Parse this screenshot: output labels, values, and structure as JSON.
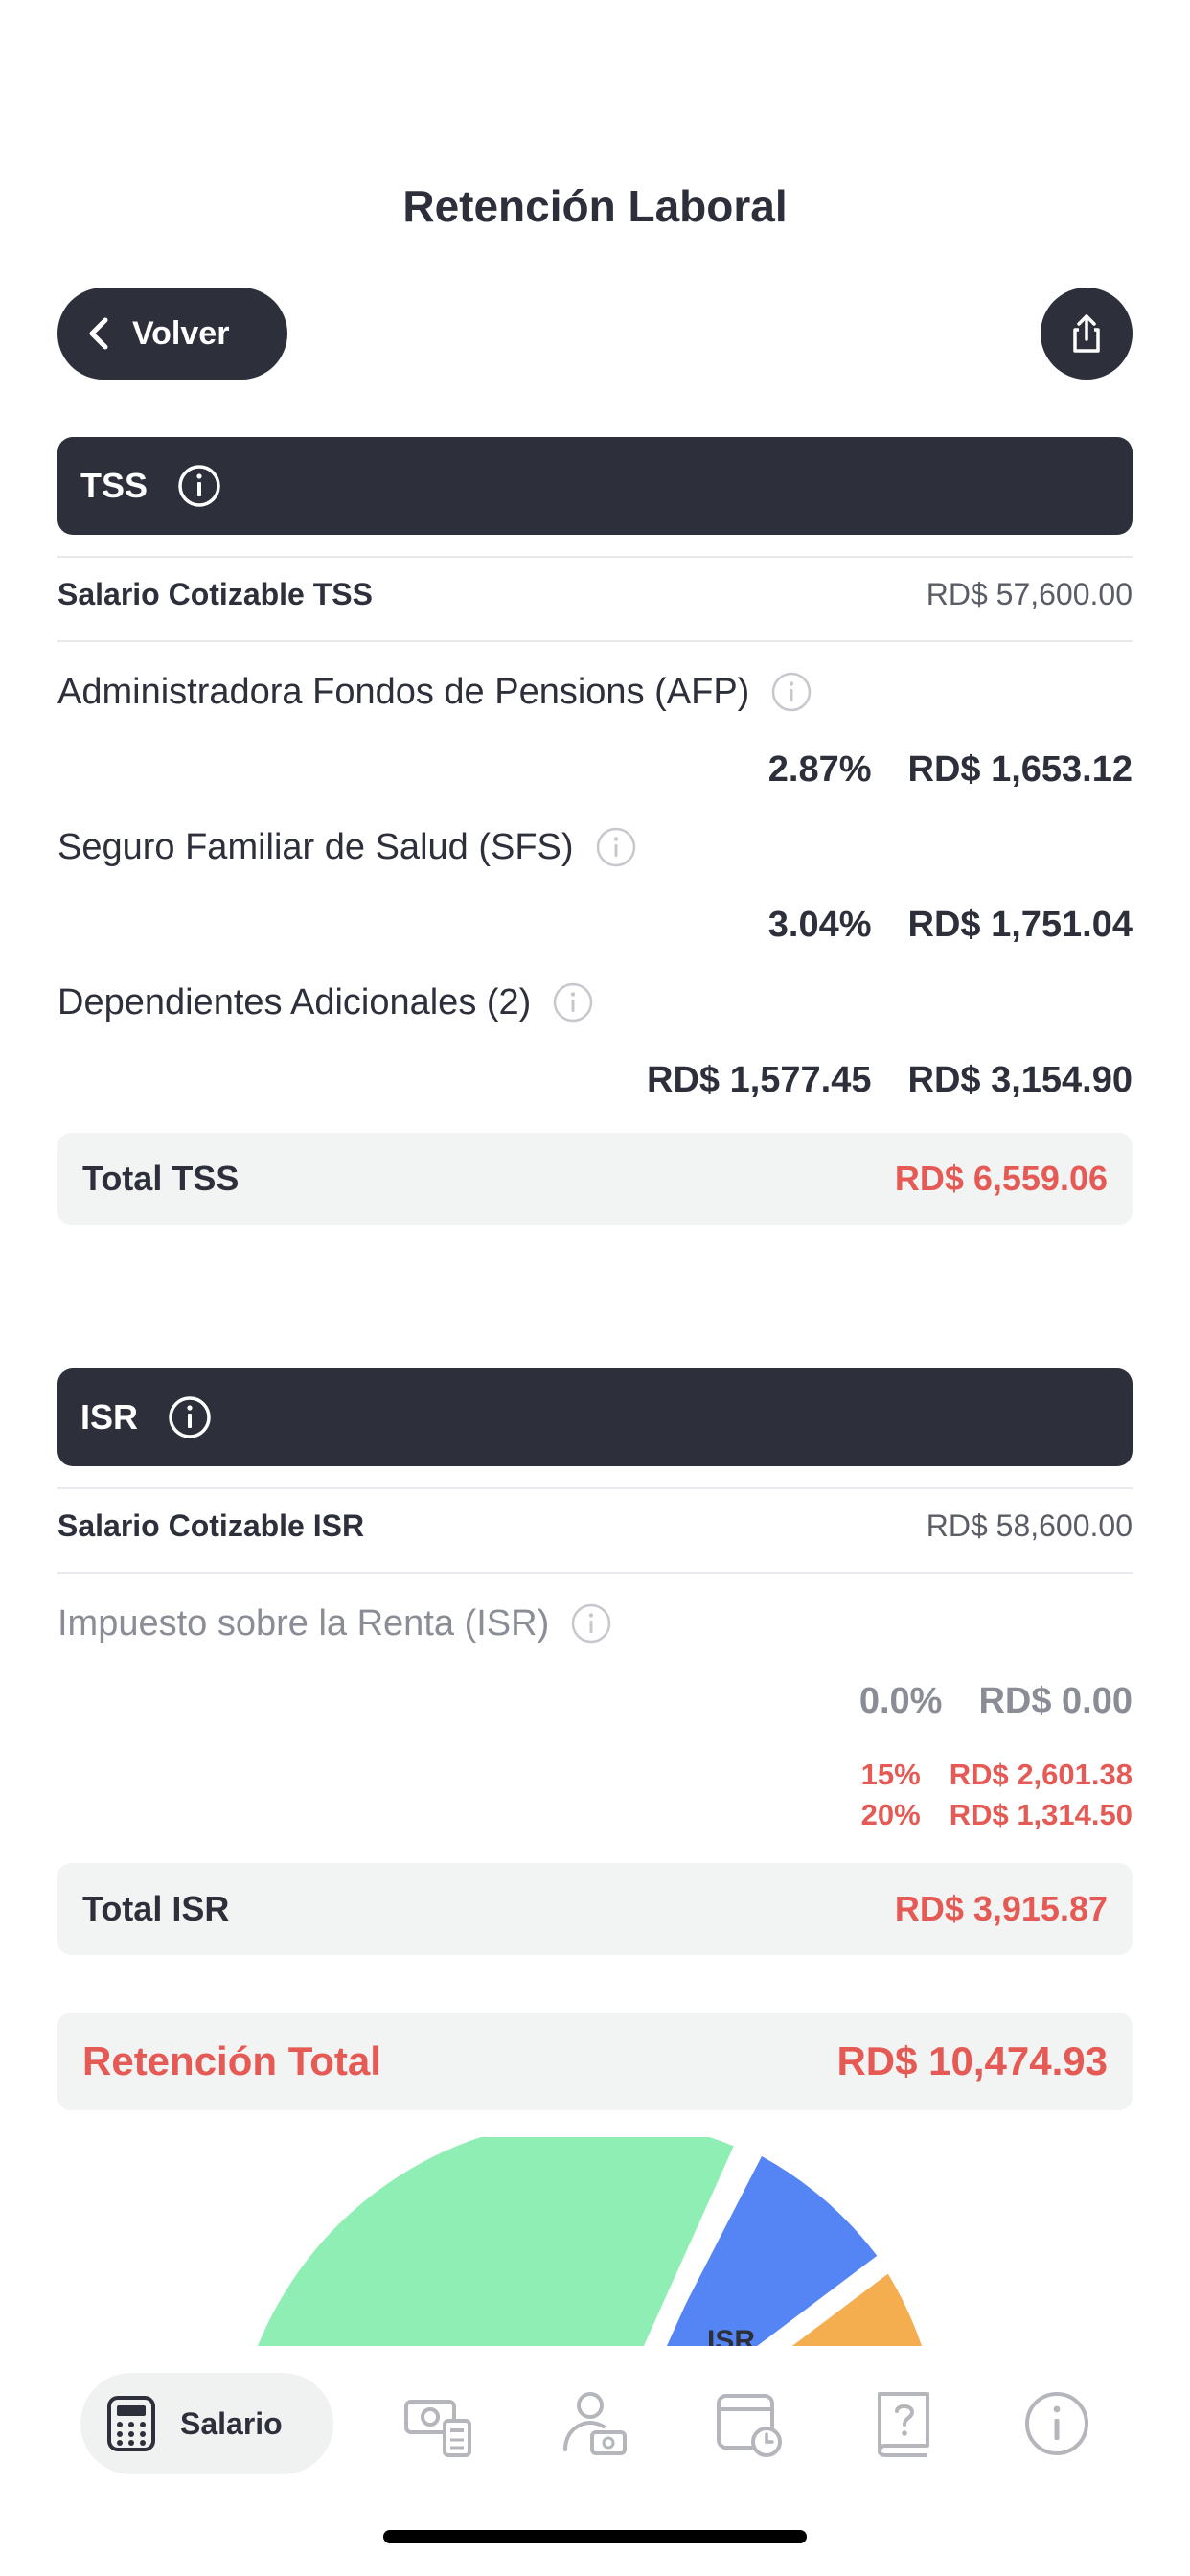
{
  "header": {
    "title": "Retención Laboral",
    "back_label": "Volver"
  },
  "tss": {
    "section_label": "TSS",
    "cotizable_label": "Salario Cotizable TSS",
    "cotizable_value": "RD$ 57,600.00",
    "items": [
      {
        "label": "Administradora Fondos de Pensions (AFP)",
        "rate": "2.87%",
        "amount": "RD$ 1,653.12"
      },
      {
        "label": "Seguro Familiar de Salud (SFS)",
        "rate": "3.04%",
        "amount": "RD$ 1,751.04"
      },
      {
        "label": "Dependientes Adicionales (2)",
        "rate": "RD$ 1,577.45",
        "amount": "RD$ 3,154.90"
      }
    ],
    "total_label": "Total TSS",
    "total_value": "RD$ 6,559.06"
  },
  "isr": {
    "section_label": "ISR",
    "cotizable_label": "Salario Cotizable ISR",
    "cotizable_value": "RD$ 58,600.00",
    "item_label": "Impuesto sobre la Renta (ISR)",
    "item_rate": "0.0%",
    "item_amount": "RD$ 0.00",
    "brackets": [
      {
        "rate": "15%",
        "amount": "RD$ 2,601.38"
      },
      {
        "rate": "20%",
        "amount": "RD$ 1,314.50"
      }
    ],
    "total_label": "Total ISR",
    "total_value": "RD$ 3,915.87"
  },
  "grand_total": {
    "label": "Retención Total",
    "value": "RD$ 10,474.93"
  },
  "chart_data": {
    "type": "pie",
    "visible_label": "ISR",
    "slice_colors": [
      "#8eeeb3",
      "#5585f5",
      "#f4ad4f"
    ]
  },
  "tabbar": {
    "active_label": "Salario",
    "icons": [
      "calculator-icon",
      "cash-calculator-icon",
      "person-cash-icon",
      "calendar-clock-icon",
      "help-book-icon",
      "info-icon"
    ]
  },
  "colors": {
    "dark": "#2d303b",
    "accent_red": "#e55a55",
    "muted": "#8a8d96",
    "panel": "#f2f3f3"
  }
}
